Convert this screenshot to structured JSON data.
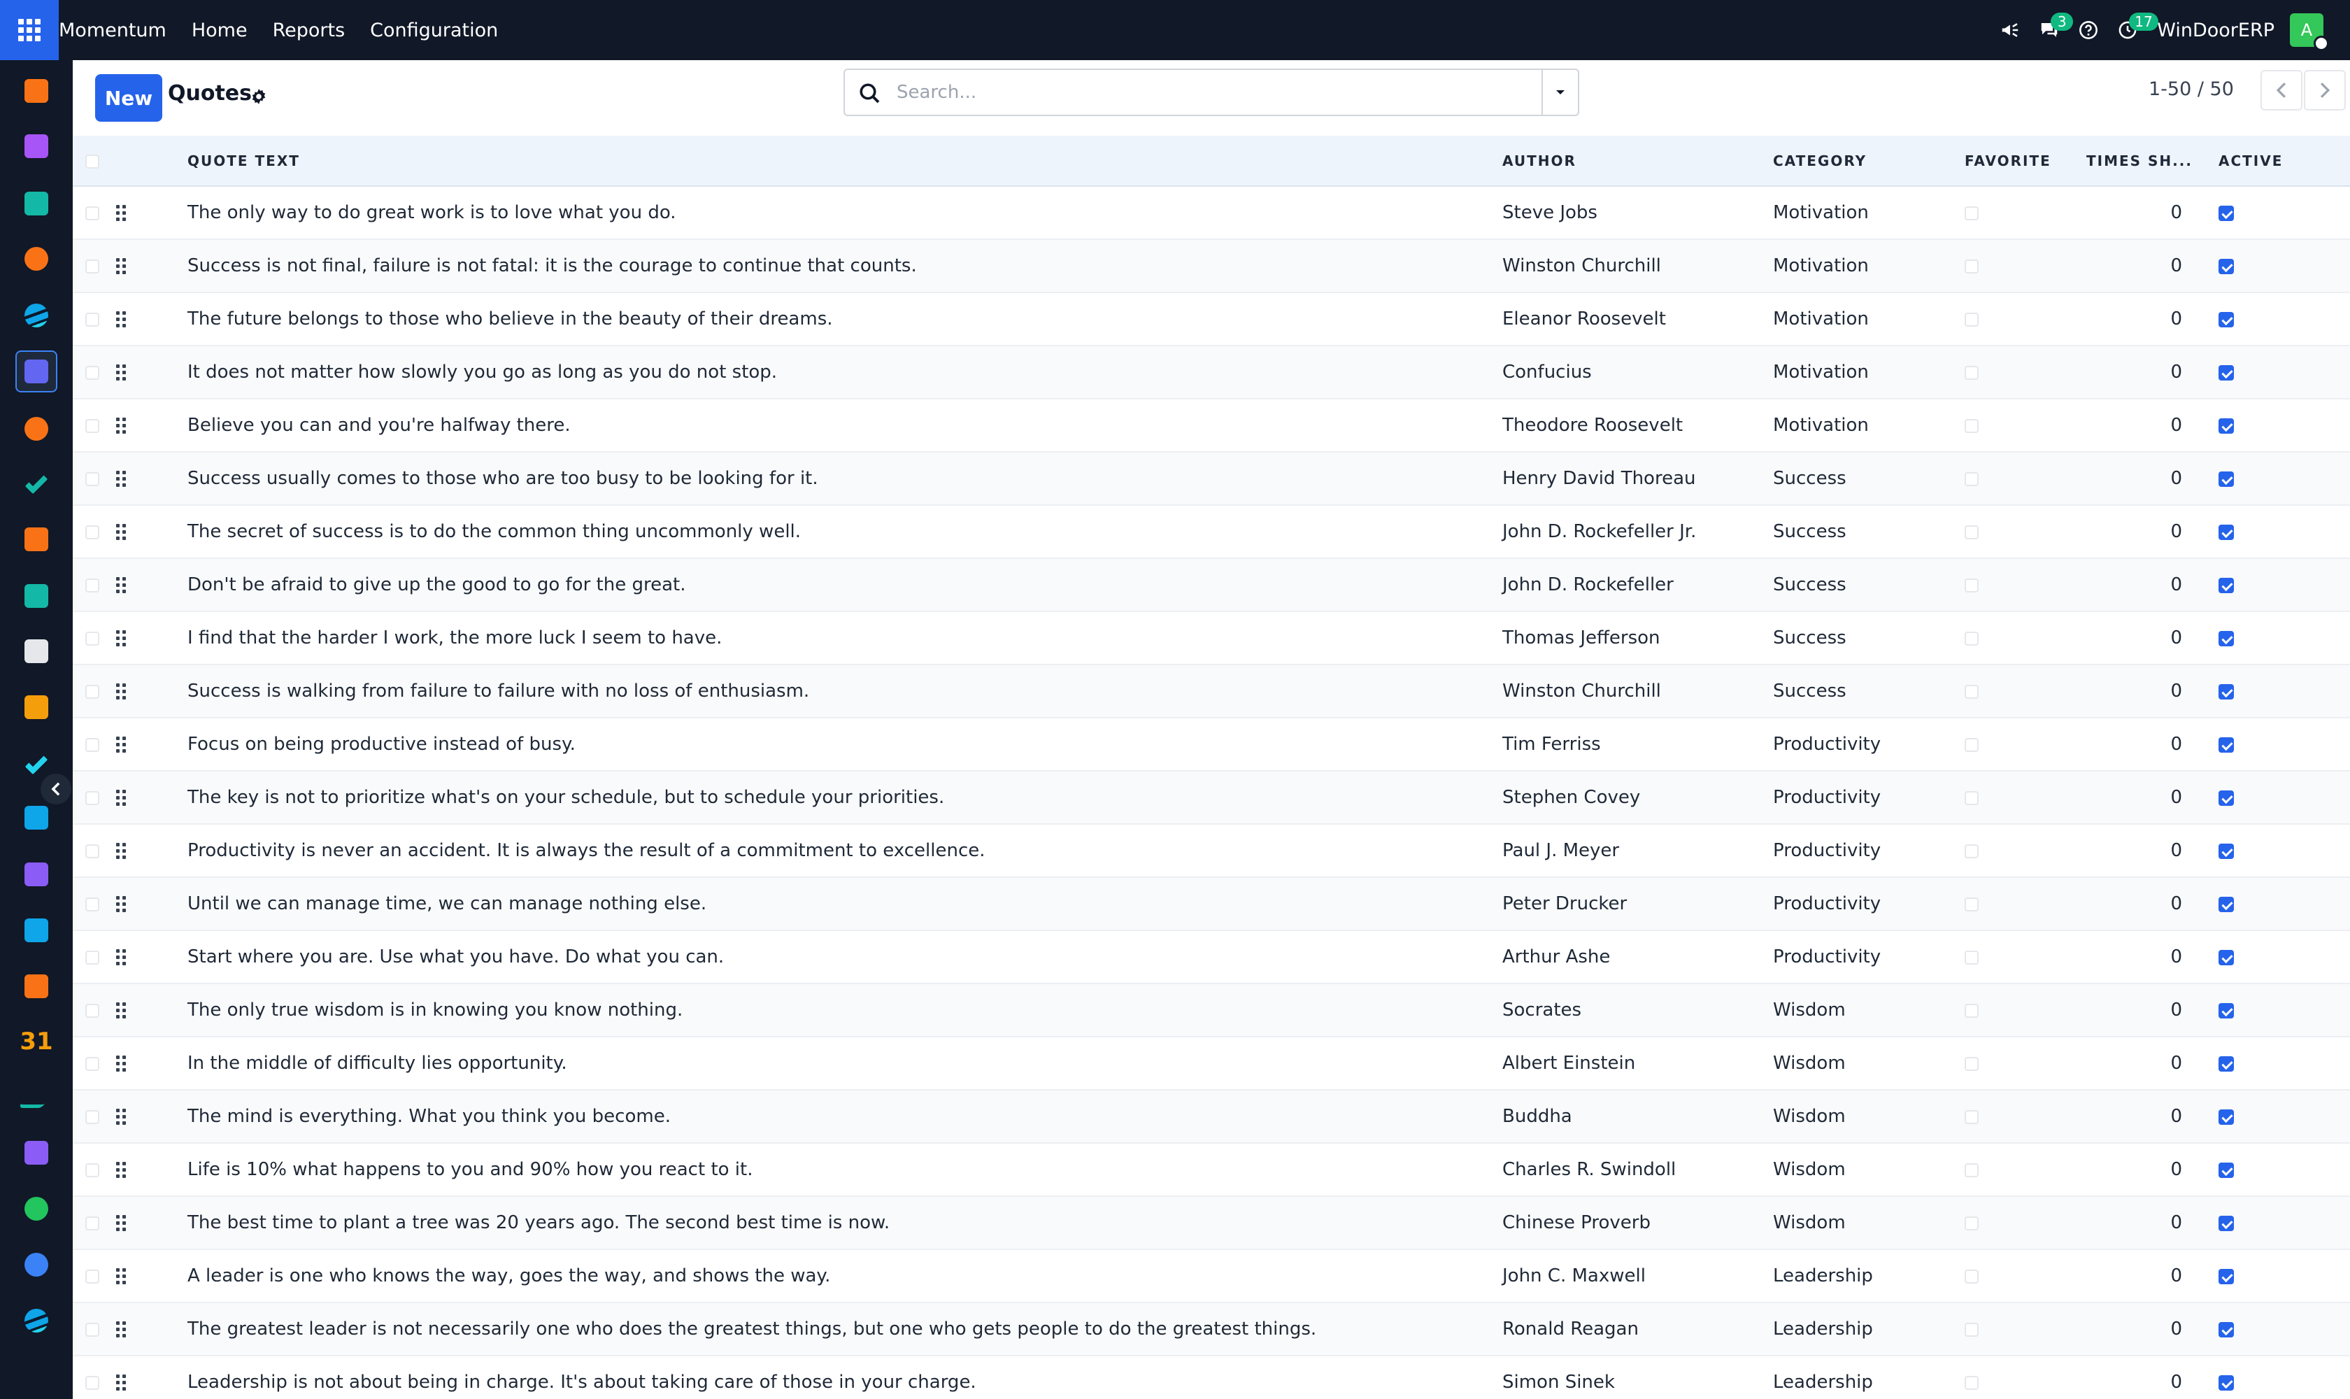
{
  "topbar": {
    "brand": "Momentum",
    "nav": [
      "Home",
      "Reports",
      "Configuration"
    ],
    "messages_count": "3",
    "activities_count": "17",
    "company": "WinDoorERP",
    "avatar_letter": "A"
  },
  "controlbar": {
    "new_label": "New",
    "title": "Quotes",
    "search_placeholder": "Search...",
    "pager": "1-50 / 50"
  },
  "table": {
    "columns": {
      "quote_text": "QUOTE TEXT",
      "author": "AUTHOR",
      "category": "CATEGORY",
      "favorite": "FAVORITE",
      "times_shown": "TIMES SH...",
      "active": "ACTIVE"
    },
    "rows": [
      {
        "quote": "The only way to do great work is to love what you do.",
        "author": "Steve Jobs",
        "category": "Motivation",
        "times": "0",
        "favorite": false,
        "active": true
      },
      {
        "quote": "Success is not final, failure is not fatal: it is the courage to continue that counts.",
        "author": "Winston Churchill",
        "category": "Motivation",
        "times": "0",
        "favorite": false,
        "active": true
      },
      {
        "quote": "The future belongs to those who believe in the beauty of their dreams.",
        "author": "Eleanor Roosevelt",
        "category": "Motivation",
        "times": "0",
        "favorite": false,
        "active": true
      },
      {
        "quote": "It does not matter how slowly you go as long as you do not stop.",
        "author": "Confucius",
        "category": "Motivation",
        "times": "0",
        "favorite": false,
        "active": true
      },
      {
        "quote": "Believe you can and you're halfway there.",
        "author": "Theodore Roosevelt",
        "category": "Motivation",
        "times": "0",
        "favorite": false,
        "active": true
      },
      {
        "quote": "Success usually comes to those who are too busy to be looking for it.",
        "author": "Henry David Thoreau",
        "category": "Success",
        "times": "0",
        "favorite": false,
        "active": true
      },
      {
        "quote": "The secret of success is to do the common thing uncommonly well.",
        "author": "John D. Rockefeller Jr.",
        "category": "Success",
        "times": "0",
        "favorite": false,
        "active": true
      },
      {
        "quote": "Don't be afraid to give up the good to go for the great.",
        "author": "John D. Rockefeller",
        "category": "Success",
        "times": "0",
        "favorite": false,
        "active": true
      },
      {
        "quote": "I find that the harder I work, the more luck I seem to have.",
        "author": "Thomas Jefferson",
        "category": "Success",
        "times": "0",
        "favorite": false,
        "active": true
      },
      {
        "quote": "Success is walking from failure to failure with no loss of enthusiasm.",
        "author": "Winston Churchill",
        "category": "Success",
        "times": "0",
        "favorite": false,
        "active": true
      },
      {
        "quote": "Focus on being productive instead of busy.",
        "author": "Tim Ferriss",
        "category": "Productivity",
        "times": "0",
        "favorite": false,
        "active": true
      },
      {
        "quote": "The key is not to prioritize what's on your schedule, but to schedule your priorities.",
        "author": "Stephen Covey",
        "category": "Productivity",
        "times": "0",
        "favorite": false,
        "active": true
      },
      {
        "quote": "Productivity is never an accident. It is always the result of a commitment to excellence.",
        "author": "Paul J. Meyer",
        "category": "Productivity",
        "times": "0",
        "favorite": false,
        "active": true
      },
      {
        "quote": "Until we can manage time, we can manage nothing else.",
        "author": "Peter Drucker",
        "category": "Productivity",
        "times": "0",
        "favorite": false,
        "active": true
      },
      {
        "quote": "Start where you are. Use what you have. Do what you can.",
        "author": "Arthur Ashe",
        "category": "Productivity",
        "times": "0",
        "favorite": false,
        "active": true
      },
      {
        "quote": "The only true wisdom is in knowing you know nothing.",
        "author": "Socrates",
        "category": "Wisdom",
        "times": "0",
        "favorite": false,
        "active": true
      },
      {
        "quote": "In the middle of difficulty lies opportunity.",
        "author": "Albert Einstein",
        "category": "Wisdom",
        "times": "0",
        "favorite": false,
        "active": true
      },
      {
        "quote": "The mind is everything. What you think you become.",
        "author": "Buddha",
        "category": "Wisdom",
        "times": "0",
        "favorite": false,
        "active": true
      },
      {
        "quote": "Life is 10% what happens to you and 90% how you react to it.",
        "author": "Charles R. Swindoll",
        "category": "Wisdom",
        "times": "0",
        "favorite": false,
        "active": true
      },
      {
        "quote": "The best time to plant a tree was 20 years ago. The second best time is now.",
        "author": "Chinese Proverb",
        "category": "Wisdom",
        "times": "0",
        "favorite": false,
        "active": true
      },
      {
        "quote": "A leader is one who knows the way, goes the way, and shows the way.",
        "author": "John C. Maxwell",
        "category": "Leadership",
        "times": "0",
        "favorite": false,
        "active": true
      },
      {
        "quote": "The greatest leader is not necessarily one who does the greatest things, but one who gets people to do the greatest things.",
        "author": "Ronald Reagan",
        "category": "Leadership",
        "times": "0",
        "favorite": false,
        "active": true
      },
      {
        "quote": "Leadership is not about being in charge. It's about taking care of those in your charge.",
        "author": "Simon Sinek",
        "category": "Leadership",
        "times": "0",
        "favorite": false,
        "active": true
      }
    ]
  },
  "sidebar": {
    "items": [
      {
        "icon": "bar-chart-icon",
        "color": "#f97316"
      },
      {
        "icon": "image-icon",
        "color": "#a855f7"
      },
      {
        "icon": "contact-icon",
        "color": "#14b8a6"
      },
      {
        "icon": "chat-bubble-icon",
        "color": "#f97316"
      },
      {
        "icon": "wave-icon",
        "color": "#0ea5e9"
      },
      {
        "icon": "mail-icon",
        "color": "#6366f1"
      },
      {
        "icon": "chat-bubble-icon",
        "color": "#f97316"
      },
      {
        "icon": "checkmark-icon",
        "color": "#14b8a6"
      },
      {
        "icon": "bar-chart-icon",
        "color": "#f97316"
      },
      {
        "icon": "contact-icon",
        "color": "#14b8a6"
      },
      {
        "icon": "cube-icon",
        "color": "#e5e7eb"
      },
      {
        "icon": "image-icon",
        "color": "#f59e0b"
      },
      {
        "icon": "check-icon",
        "color": "#22d3ee"
      },
      {
        "icon": "book-icon",
        "color": "#0ea5e9"
      },
      {
        "icon": "box-icon",
        "color": "#8b5cf6"
      },
      {
        "icon": "invoice-icon",
        "color": "#0ea5e9"
      },
      {
        "icon": "team-icon",
        "color": "#f97316"
      },
      {
        "icon": "calendar-icon",
        "color": "#f59e0b",
        "text": "31"
      },
      {
        "icon": "sign-icon",
        "color": "#14b8a6"
      },
      {
        "icon": "dashboard-icon",
        "color": "#8b5cf6"
      },
      {
        "icon": "whatsapp-icon",
        "color": "#22c55e"
      },
      {
        "icon": "clock-icon",
        "color": "#3b82f6"
      },
      {
        "icon": "wave-icon",
        "color": "#0ea5e9"
      }
    ]
  }
}
